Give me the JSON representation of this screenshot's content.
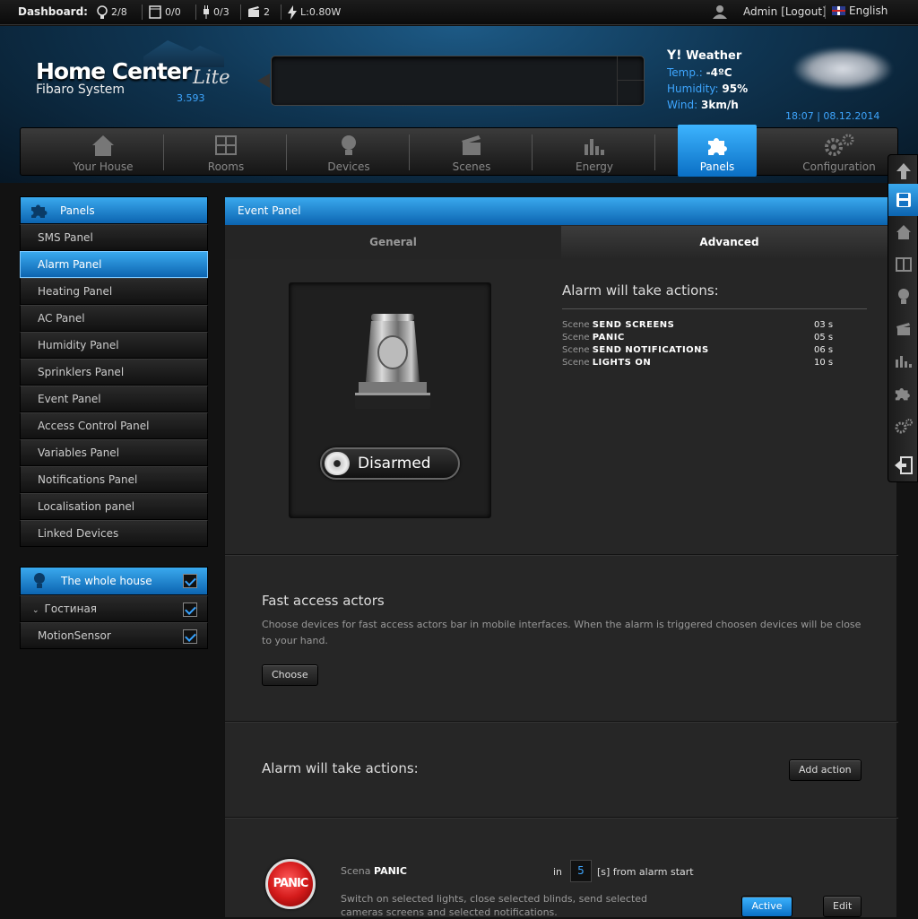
{
  "topbar": {
    "dashboard_label": "Dashboard:",
    "stats": [
      {
        "icon": "bulb-icon",
        "value": "2/8"
      },
      {
        "icon": "blinds-icon",
        "value": "0/0"
      },
      {
        "icon": "plug-icon",
        "value": "0/3"
      },
      {
        "icon": "scenes-icon",
        "value": "2"
      },
      {
        "icon": "power-icon",
        "value": "L:0.80W"
      }
    ],
    "user": "Admin",
    "logout": "[Logout]",
    "language": "English"
  },
  "header": {
    "logo_title": "Home Center",
    "logo_sub": "Fibaro System",
    "logo_edition": "Lite",
    "version": "3.593",
    "weather": {
      "title": "Weather",
      "temp_label": "Temp.:",
      "temp_value": "-4ºC",
      "humidity_label": "Humidity:",
      "humidity_value": "95%",
      "wind_label": "Wind:",
      "wind_value": "3km/h"
    },
    "datetime": "18:07 | 08.12.2014"
  },
  "nav": {
    "tabs": [
      {
        "label": "Your House",
        "icon": "house-icon"
      },
      {
        "label": "Rooms",
        "icon": "rooms-icon"
      },
      {
        "label": "Devices",
        "icon": "bulb-icon"
      },
      {
        "label": "Scenes",
        "icon": "clapper-icon"
      },
      {
        "label": "Energy",
        "icon": "chart-icon"
      },
      {
        "label": "Panels",
        "icon": "puzzle-icon"
      },
      {
        "label": "Configuration",
        "icon": "gears-icon"
      }
    ],
    "active": "Panels"
  },
  "sidebar": {
    "title": "Panels",
    "items": [
      {
        "label": "SMS Panel"
      },
      {
        "label": "Alarm Panel"
      },
      {
        "label": "Heating Panel"
      },
      {
        "label": "AC Panel"
      },
      {
        "label": "Humidity Panel"
      },
      {
        "label": "Sprinklers Panel"
      },
      {
        "label": "Event Panel"
      },
      {
        "label": "Access Control Panel"
      },
      {
        "label": "Variables Panel"
      },
      {
        "label": "Notifications Panel"
      },
      {
        "label": "Localisation panel"
      },
      {
        "label": "Linked Devices"
      }
    ],
    "active": "Alarm Panel"
  },
  "house": {
    "title": "The whole house",
    "room": "Гостиная",
    "device": "MotionSensor"
  },
  "main": {
    "title": "Event Panel",
    "tabs": [
      "General",
      "Advanced"
    ],
    "active_tab": "Advanced",
    "alarm_state": "Disarmed",
    "actions_title": "Alarm will take actions:",
    "actions": [
      {
        "prefix": "Scene",
        "name": "SEND SCREENS",
        "time": "03 s"
      },
      {
        "prefix": "Scene",
        "name": "PANIC",
        "time": "05 s"
      },
      {
        "prefix": "Scene",
        "name": "SEND NOTIFICATIONS",
        "time": "06 s"
      },
      {
        "prefix": "Scene",
        "name": "LIGHTS ON",
        "time": "10 s"
      }
    ],
    "fast_access": {
      "title": "Fast access actors",
      "description": "Choose devices for fast access actors bar in mobile interfaces. When the alarm is triggered choosen devices will be close to your hand.",
      "button": "Choose"
    },
    "actions2_title": "Alarm will take actions:",
    "add_action": "Add action",
    "scene_item": {
      "badge": "PANIC",
      "prefix": "Scena",
      "name": "PANIC",
      "in_label": "in",
      "delay": "5",
      "from_label": "[s] from alarm start",
      "description": "Switch on selected lights, close selected blinds, send selected cameras screens and selected notifications.",
      "active_button": "Active",
      "edit_button": "Edit"
    }
  },
  "colors": {
    "accent": "#0c64b0",
    "accent_light": "#3aa9ee",
    "link": "#3ea6ff"
  }
}
